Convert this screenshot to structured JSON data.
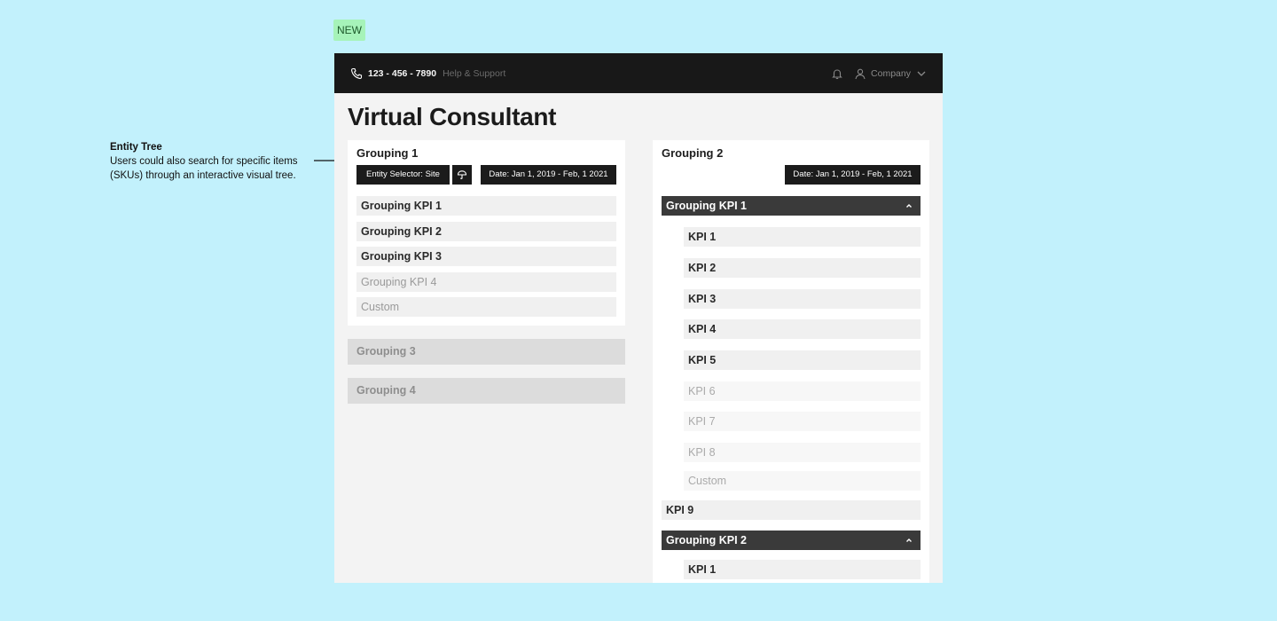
{
  "badge": "NEW",
  "annotation": {
    "title": "Entity Tree",
    "text": "Users could also search for specific items (SKUs) through an interactive visual tree."
  },
  "topbar": {
    "phone": "123 - 456 - 7890",
    "help": "Help & Support",
    "company": "Company"
  },
  "page_title": "Virtual Consultant",
  "grouping1": {
    "title": "Grouping 1",
    "entity_selector": "Entity Selector:  Site",
    "date": "Date:   Jan 1, 2019 - Feb, 1 2021",
    "items": [
      "Grouping KPI 1",
      "Grouping KPI 2",
      "Grouping KPI 3",
      "Grouping KPI 4",
      "Custom"
    ]
  },
  "grouping3": "Grouping 3",
  "grouping4": "Grouping 4",
  "grouping2": {
    "title": "Grouping 2",
    "date": "Date:   Jan 1, 2019 - Feb, 1 2021",
    "kpi_group1": "Grouping KPI 1",
    "kpis": [
      "KPI 1",
      "KPI 2",
      "KPI 3",
      "KPI 4",
      "KPI 5",
      "KPI 6",
      "KPI 7",
      "KPI 8",
      "Custom"
    ],
    "kpi9": "KPI 9",
    "kpi_group2": "Grouping KPI 2",
    "kpi_group2_first": "KPI 1"
  }
}
